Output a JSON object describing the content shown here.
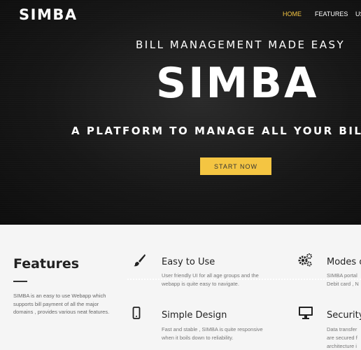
{
  "header": {
    "brand": "SIMBA",
    "nav": [
      {
        "label": "HOME",
        "active": true
      },
      {
        "label": "FEATURES",
        "active": false
      },
      {
        "label": "US",
        "active": false
      }
    ]
  },
  "hero": {
    "tagline": "BILL MANAGEMENT MADE EASY",
    "title": "SIMBA",
    "subtitle": "A PLATFORM TO MANAGE ALL YOUR BILLING ACTIV",
    "cta_label": "START NOW"
  },
  "features": {
    "heading": "Features",
    "description": "SIMBA is an easy to use Webapp which supports bill payment of all the major domains , provides various neat features.",
    "cards": [
      {
        "icon": "paintbrush-icon",
        "title": "Easy to Use",
        "text_lines": [
          "User friendly UI for all age groups and the",
          "webapp is quite easy to navigate."
        ]
      },
      {
        "icon": "gears-icon",
        "title": "Modes o",
        "text_lines": [
          "SIMBA portal",
          "Debit card , N"
        ]
      },
      {
        "icon": "mobile-icon",
        "title": "Simple Design",
        "text_lines": [
          "Fast and stable , SIMBA is quite responsive",
          "when it boils down to reliability."
        ]
      },
      {
        "icon": "monitor-icon",
        "title": "Security",
        "text_lines": [
          "Data transfer",
          "are secured f",
          "architecture i"
        ]
      }
    ]
  },
  "colors": {
    "accent": "#f4c542",
    "hero_bg": "#161616",
    "section_bg": "#f5f5f5"
  }
}
